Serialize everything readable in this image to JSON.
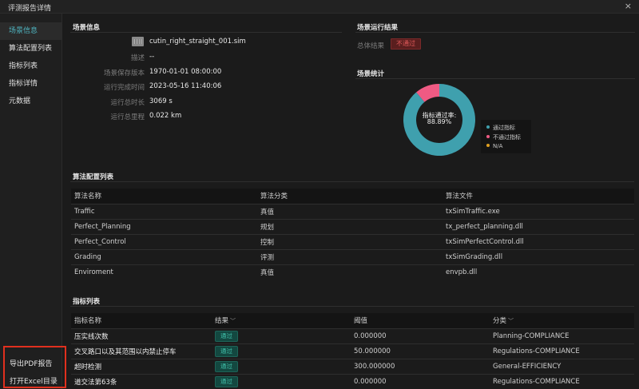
{
  "window": {
    "title": "评测报告详情",
    "close": "×"
  },
  "sidebar": {
    "items": [
      {
        "label": "场景信息",
        "active": true
      },
      {
        "label": "算法配置列表"
      },
      {
        "label": "指标列表"
      },
      {
        "label": "指标详情"
      },
      {
        "label": "元数据"
      }
    ],
    "export_pdf": "导出PDF报告",
    "open_excel": "打开Excel目录"
  },
  "scene_info": {
    "title": "场景信息",
    "file_name": "cutin_right_straight_001.sim",
    "fields": [
      {
        "label": "描述",
        "value": "--"
      },
      {
        "label": "场景保存版本",
        "value": "1970-01-01 08:00:00"
      },
      {
        "label": "运行完成时间",
        "value": "2023-05-16 11:40:06"
      },
      {
        "label": "运行总时长",
        "value": "3069 s"
      },
      {
        "label": "运行总里程",
        "value": "0.022 km"
      }
    ]
  },
  "run_result": {
    "title": "场景运行结果",
    "label": "总体结果",
    "value": "不通过",
    "badge_color": "#e05a5a"
  },
  "stats": {
    "title": "场景统计",
    "center_label": "指标通过率:",
    "center_value": "88.89%",
    "legend": [
      {
        "label": "通过指标",
        "color": "#3fa0ae"
      },
      {
        "label": "不通过指标",
        "color": "#ef5a83"
      },
      {
        "label": "N/A",
        "color": "#e0a020"
      }
    ]
  },
  "chart_data": {
    "type": "pie",
    "categories": [
      "通过指标",
      "不通过指标",
      "N/A"
    ],
    "values": [
      88.89,
      11.11,
      0
    ],
    "colors": [
      "#3fa0ae",
      "#ef5a83",
      "#e0a020"
    ],
    "legend_position": "right"
  },
  "algo": {
    "title": "算法配置列表",
    "headers": [
      "算法名称",
      "算法分类",
      "算法文件"
    ],
    "rows": [
      [
        "Traffic",
        "真值",
        "txSimTraffic.exe"
      ],
      [
        "Perfect_Planning",
        "规划",
        "tx_perfect_planning.dll"
      ],
      [
        "Perfect_Control",
        "控制",
        "txSimPerfectControl.dll"
      ],
      [
        "Grading",
        "评测",
        "txSimGrading.dll"
      ],
      [
        "Enviroment",
        "真值",
        "envpb.dll"
      ]
    ]
  },
  "metrics": {
    "title": "指标列表",
    "headers": [
      "指标名称",
      "结果",
      "阈值",
      "分类"
    ],
    "pass_label": "通过",
    "rows": [
      [
        "压实线次数",
        "通过",
        "0.000000",
        "Planning-COMPLIANCE"
      ],
      [
        "交叉路口以及其范围以内禁止停车",
        "通过",
        "50.000000",
        "Regulations-COMPLIANCE"
      ],
      [
        "超时检测",
        "通过",
        "300.000000",
        "General-EFFICIENCY"
      ],
      [
        "道交法第63条",
        "通过",
        "0.000000",
        "Regulations-COMPLIANCE"
      ]
    ]
  }
}
